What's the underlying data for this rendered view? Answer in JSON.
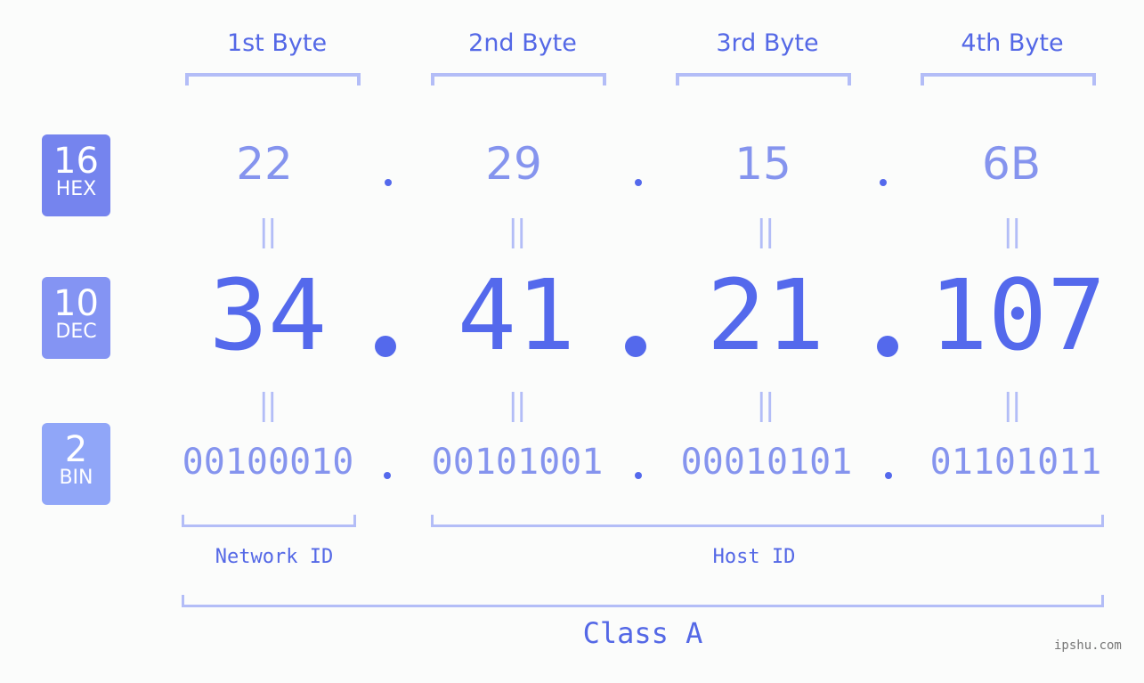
{
  "bytes": [
    {
      "label": "1st Byte",
      "hex": "22",
      "dec": "34",
      "bin": "00100010"
    },
    {
      "label": "2nd Byte",
      "hex": "29",
      "dec": "41",
      "bin": "00101001"
    },
    {
      "label": "3rd Byte",
      "hex": "15",
      "dec": "21",
      "bin": "00010101"
    },
    {
      "label": "4th Byte",
      "hex": "6B",
      "dec": "107",
      "bin": "01101011"
    }
  ],
  "badges": {
    "hex": {
      "base": "16",
      "name": "HEX",
      "color": "#7584ee"
    },
    "dec": {
      "base": "10",
      "name": "DEC",
      "color": "#8494f3"
    },
    "bin": {
      "base": "2",
      "name": "BIN",
      "color": "#90a6f8"
    }
  },
  "equals_symbol": "||",
  "segments": {
    "network": "Network ID",
    "host": "Host ID",
    "class": "Class A"
  },
  "colors": {
    "primary": "#5469ec",
    "secondary": "#8594ee",
    "bracket": "#b3bdf7",
    "background": "#fbfcfb"
  },
  "watermark": "ipshu.com"
}
